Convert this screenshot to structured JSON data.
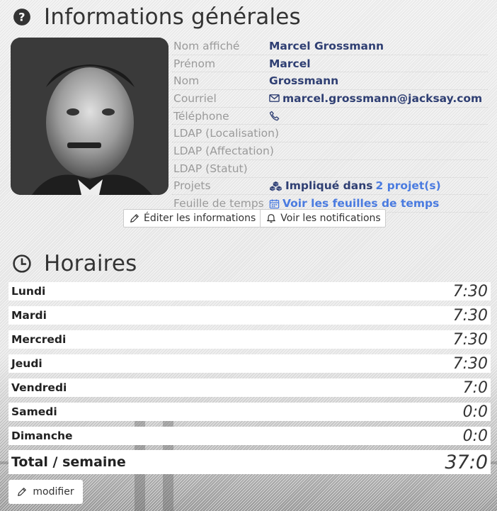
{
  "info_section": {
    "title": "Informations générales",
    "icon": "question-circle-icon",
    "fields": {
      "display_name": {
        "label": "Nom affiché",
        "value": "Marcel Grossmann"
      },
      "first_name": {
        "label": "Prénom",
        "value": "Marcel"
      },
      "last_name": {
        "label": "Nom",
        "value": "Grossmann"
      },
      "email": {
        "label": "Courriel",
        "value": "marcel.grossmann@jacksay.com",
        "icon": "envelope-icon"
      },
      "phone": {
        "label": "Téléphone",
        "value": "",
        "icon": "phone-icon"
      },
      "ldap_location": {
        "label": "LDAP (Localisation)",
        "value": ""
      },
      "ldap_assignment": {
        "label": "LDAP (Affectation)",
        "value": ""
      },
      "ldap_status": {
        "label": "LDAP (Statut)",
        "value": ""
      },
      "projects": {
        "label": "Projets",
        "prefix": "Impliqué dans",
        "link": "2 projet(s)",
        "icon": "cubes-icon"
      },
      "timesheet": {
        "label": "Feuille de temps",
        "link": "Voir les feuilles de temps",
        "icon": "calendar-icon"
      }
    },
    "buttons": {
      "edit": "Éditer les informations",
      "notifications": "Voir les notifications"
    }
  },
  "hours_section": {
    "title": "Horaires",
    "icon": "clock-icon",
    "days": [
      {
        "day": "Lundi",
        "hours": "7:30"
      },
      {
        "day": "Mardi",
        "hours": "7:30"
      },
      {
        "day": "Mercredi",
        "hours": "7:30"
      },
      {
        "day": "Jeudi",
        "hours": "7:30"
      },
      {
        "day": "Vendredi",
        "hours": "7:0"
      },
      {
        "day": "Samedi",
        "hours": "0:0"
      },
      {
        "day": "Dimanche",
        "hours": "0:0"
      }
    ],
    "total": {
      "label": "Total / semaine",
      "hours": "37:0"
    },
    "modify_button": "modifier"
  },
  "colors": {
    "label": "#9a9a9a",
    "value": "#2f3f73",
    "link": "#4a7be0"
  }
}
